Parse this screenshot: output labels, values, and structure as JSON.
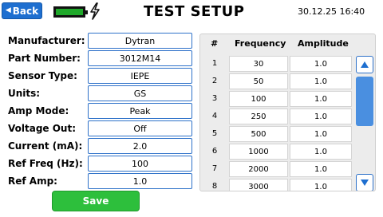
{
  "header": {
    "back_label": "Back",
    "title": "TEST SETUP",
    "datetime": "30.12.25 16:40"
  },
  "colors": {
    "accent": "#1e6fd0",
    "save_button": "#2dbf3c",
    "battery_fill": "#1fa82a"
  },
  "icons": {
    "back": "left-triangle",
    "battery": "battery-full",
    "charging": "lightning-bolt",
    "scroll_up": "up-triangle",
    "scroll_down": "down-triangle"
  },
  "form": {
    "fields": [
      {
        "label": "Manufacturer:",
        "value": "Dytran"
      },
      {
        "label": "Part Number:",
        "value": "3012M14"
      },
      {
        "label": "Sensor Type:",
        "value": "IEPE"
      },
      {
        "label": "Units:",
        "value": "GS"
      },
      {
        "label": "Amp Mode:",
        "value": "Peak"
      },
      {
        "label": "Voltage Out:",
        "value": "Off"
      },
      {
        "label": "Current (mA):",
        "value": "2.0"
      },
      {
        "label": "Ref Freq (Hz):",
        "value": "100"
      },
      {
        "label": "Ref Amp:",
        "value": "1.0"
      }
    ],
    "save_label": "Save"
  },
  "table": {
    "headers": {
      "num": "#",
      "frequency": "Frequency",
      "amplitude": "Amplitude"
    },
    "rows": [
      {
        "num": "1",
        "frequency": "30",
        "amplitude": "1.0"
      },
      {
        "num": "2",
        "frequency": "50",
        "amplitude": "1.0"
      },
      {
        "num": "3",
        "frequency": "100",
        "amplitude": "1.0"
      },
      {
        "num": "4",
        "frequency": "250",
        "amplitude": "1.0"
      },
      {
        "num": "5",
        "frequency": "500",
        "amplitude": "1.0"
      },
      {
        "num": "6",
        "frequency": "1000",
        "amplitude": "1.0"
      },
      {
        "num": "7",
        "frequency": "2000",
        "amplitude": "1.0"
      },
      {
        "num": "8",
        "frequency": "3000",
        "amplitude": "1.0"
      }
    ]
  }
}
